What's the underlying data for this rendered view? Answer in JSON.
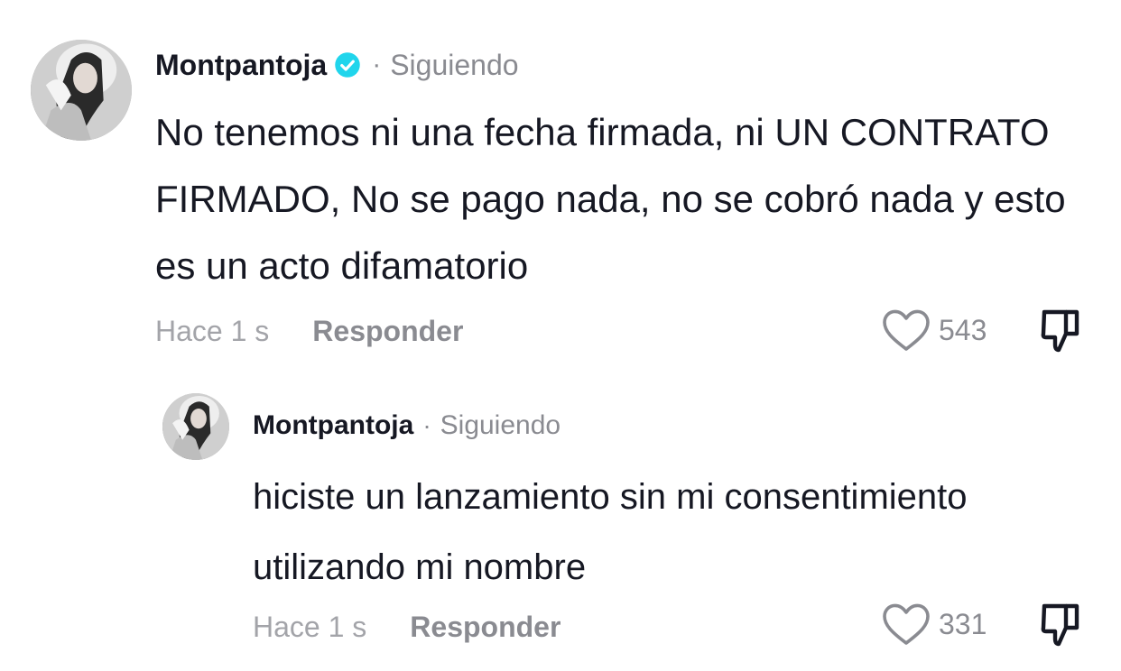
{
  "comments": [
    {
      "username": "Montpantoja",
      "verified": true,
      "separator": "·",
      "following_label": "Siguiendo",
      "text": "No tenemos ni una fecha firmada, ni UN CONTRATO FIRMADO, No se pago nada, no se cobró nada y esto es un acto difamatorio",
      "timestamp": "Hace 1 s",
      "reply_label": "Responder",
      "likes": "543"
    },
    {
      "username": "Montpantoja",
      "verified": false,
      "separator": "·",
      "following_label": "Siguiendo",
      "text": "hiciste un lanzamiento sin mi consentimiento utilizando mi nombre",
      "timestamp": "Hace 1 s",
      "reply_label": "Responder",
      "likes": "331"
    }
  ],
  "icons": {
    "verified": "verified-badge-icon",
    "like": "heart-icon",
    "dislike": "thumbs-down-icon"
  },
  "colors": {
    "text": "#161823",
    "muted": "#8a8b91",
    "timestamp": "#a3a4a9",
    "verified": "#20d5ec"
  }
}
